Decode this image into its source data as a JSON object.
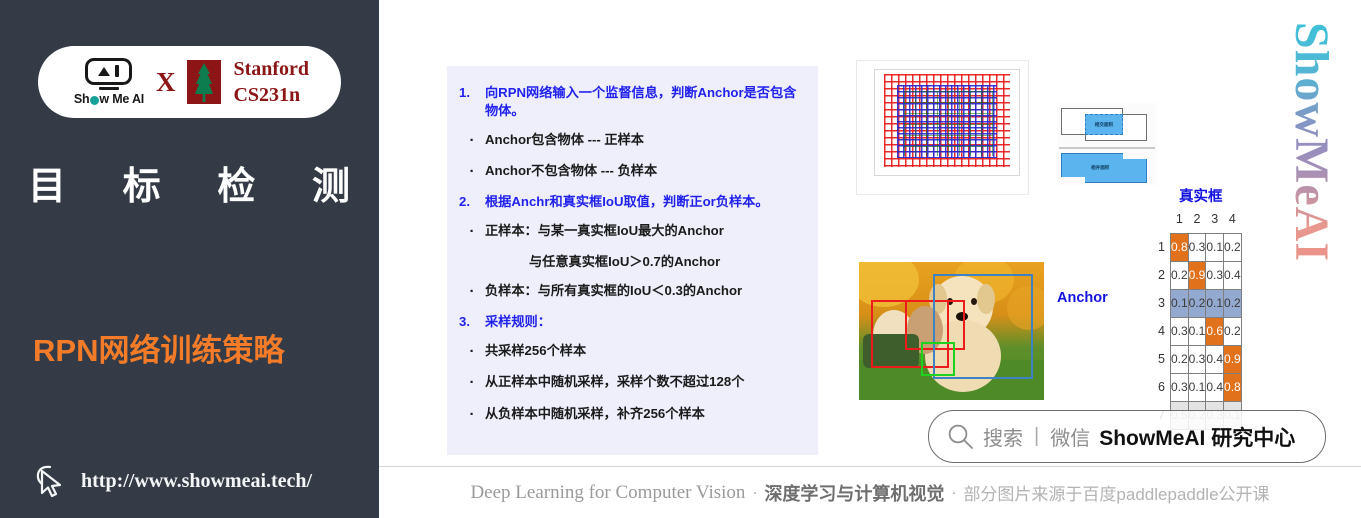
{
  "sidebar": {
    "logo": {
      "brand_name": "Show Me AI",
      "cross": "X",
      "partner_line1": "Stanford",
      "partner_line2": "CS231n"
    },
    "section_title_chars": [
      "目",
      "标",
      "检",
      "测"
    ],
    "slide_title": "RPN网络训练策略",
    "url": "http://www.showmeai.tech/",
    "colors": {
      "background": "#343b47",
      "accent_orange": "#f47c28",
      "stanford_red": "#8c1515"
    }
  },
  "content": {
    "bullets": [
      {
        "marker": "1.",
        "type": "number",
        "text": "向RPN网络输入一个监督信息，判断Anchor是否包含物体。"
      },
      {
        "marker": "·",
        "type": "dot",
        "text": "Anchor包含物体 --- 正样本"
      },
      {
        "marker": "·",
        "type": "dot",
        "text": "Anchor不包含物体 --- 负样本"
      },
      {
        "marker": "2.",
        "type": "number",
        "text": "根据Anchr和真实框IoU取值，判断正or负样本。"
      },
      {
        "marker": "·",
        "type": "dot",
        "text": "正样本：与某一真实框IoU最大的Anchor"
      },
      {
        "marker": "",
        "type": "indent",
        "text": "与任意真实框IoU＞0.7的Anchor"
      },
      {
        "marker": "·",
        "type": "dot",
        "text": "负样本：与所有真实框的IoU＜0.3的Anchor"
      },
      {
        "marker": "3.",
        "type": "number",
        "text": "采样规则："
      },
      {
        "marker": "·",
        "type": "dot",
        "text": "共采样256个样本"
      },
      {
        "marker": "·",
        "type": "dot",
        "text": "从正样本中随机采样，采样个数不超过128个"
      },
      {
        "marker": "·",
        "type": "dot",
        "text": "从负样本中随机采样，补齐256个样本"
      }
    ],
    "iou_diagram": {
      "intersection_label": "相交面积",
      "union_label": "相并面积"
    },
    "matrix": {
      "col_title": "真实框",
      "row_title": "Anchor",
      "col_headers": [
        "1",
        "2",
        "3",
        "4"
      ],
      "row_headers": [
        "1",
        "2",
        "3",
        "4",
        "5",
        "6",
        "7"
      ],
      "rows": [
        {
          "cells": [
            {
              "v": "0.8",
              "s": "hi"
            },
            {
              "v": "0.3",
              "s": ""
            },
            {
              "v": "0.1",
              "s": ""
            },
            {
              "v": "0.2",
              "s": ""
            }
          ]
        },
        {
          "cells": [
            {
              "v": "0.2",
              "s": ""
            },
            {
              "v": "0.9",
              "s": "hi"
            },
            {
              "v": "0.3",
              "s": ""
            },
            {
              "v": "0.4",
              "s": ""
            }
          ]
        },
        {
          "cells": [
            {
              "v": "0.1",
              "s": "sel"
            },
            {
              "v": "0.2",
              "s": "sel"
            },
            {
              "v": "0.1",
              "s": "sel"
            },
            {
              "v": "0.2",
              "s": "sel"
            }
          ]
        },
        {
          "cells": [
            {
              "v": "0.3",
              "s": ""
            },
            {
              "v": "0.1",
              "s": ""
            },
            {
              "v": "0.6",
              "s": "hi"
            },
            {
              "v": "0.2",
              "s": ""
            }
          ]
        },
        {
          "cells": [
            {
              "v": "0.2",
              "s": ""
            },
            {
              "v": "0.3",
              "s": ""
            },
            {
              "v": "0.4",
              "s": ""
            },
            {
              "v": "0.9",
              "s": "hi"
            }
          ]
        },
        {
          "cells": [
            {
              "v": "0.3",
              "s": ""
            },
            {
              "v": "0.1",
              "s": ""
            },
            {
              "v": "0.4",
              "s": ""
            },
            {
              "v": "0.8",
              "s": "hi"
            }
          ]
        },
        {
          "cells": [
            {
              "v": "0.5",
              "s": "dim"
            },
            {
              "v": "0.2",
              "s": "dim"
            },
            {
              "v": "0.3",
              "s": "dim"
            },
            {
              "v": "0.1",
              "s": "dim"
            }
          ]
        }
      ]
    },
    "watermark": "ShowMeAI",
    "search_pill": {
      "placeholder": "搜索",
      "separator": "|",
      "channel": "微信",
      "account": "ShowMeAI 研究中心"
    },
    "footer": {
      "english": "Deep Learning for Computer Vision",
      "dot1": "·",
      "chinese_bold": "深度学习与计算机视觉",
      "dot2": "·",
      "source": "部分图片来源于百度paddlepaddle公开课"
    }
  }
}
